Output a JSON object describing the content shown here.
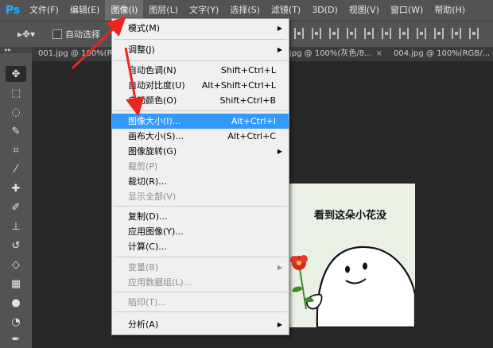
{
  "app": {
    "logo": "Ps"
  },
  "menubar": {
    "items": [
      "文件(F)",
      "编辑(E)",
      "图像(I)",
      "图层(L)",
      "文字(Y)",
      "选择(S)",
      "滤镜(T)",
      "3D(D)",
      "视图(V)",
      "窗口(W)",
      "帮助(H)"
    ],
    "active_index": 2
  },
  "options": {
    "auto_select_label": "自动选择"
  },
  "tabs": [
    {
      "label": "001.jpg @ 100%(RG",
      "close": "×"
    },
    {
      "label": "jpg @ 100%(灰色/8...",
      "close": "×"
    },
    {
      "label": "004.jpg @ 100%(RGB/...",
      "close": "×"
    }
  ],
  "image_menu": {
    "items": [
      {
        "label": "模式(M)",
        "submenu": true
      },
      {
        "label": "调整(J)",
        "submenu": true
      },
      {
        "label": "自动色调(N)",
        "shortcut": "Shift+Ctrl+L"
      },
      {
        "label": "自动对比度(U)",
        "shortcut": "Alt+Shift+Ctrl+L"
      },
      {
        "label": "自动颜色(O)",
        "shortcut": "Shift+Ctrl+B"
      },
      {
        "label": "图像大小(I)...",
        "shortcut": "Alt+Ctrl+I",
        "highlighted": true
      },
      {
        "label": "画布大小(S)...",
        "shortcut": "Alt+Ctrl+C"
      },
      {
        "label": "图像旋转(G)",
        "submenu": true
      },
      {
        "label": "裁剪(P)",
        "disabled": true
      },
      {
        "label": "裁切(R)..."
      },
      {
        "label": "显示全部(V)",
        "disabled": true
      },
      {
        "label": "复制(D)..."
      },
      {
        "label": "应用图像(Y)..."
      },
      {
        "label": "计算(C)..."
      },
      {
        "label": "变量(B)",
        "submenu": true,
        "disabled": true
      },
      {
        "label": "应用数据组(L)...",
        "disabled": true
      },
      {
        "label": "陷印(T)...",
        "disabled": true
      },
      {
        "label": "分析(A)",
        "submenu": true
      }
    ],
    "submenu_arrow": "▶"
  },
  "canvas_image": {
    "caption": "看到这朵小花没"
  },
  "colors": {
    "highlight": "#3399ff",
    "annotation": "#e8271e",
    "ps_blue": "#31a8ff"
  }
}
